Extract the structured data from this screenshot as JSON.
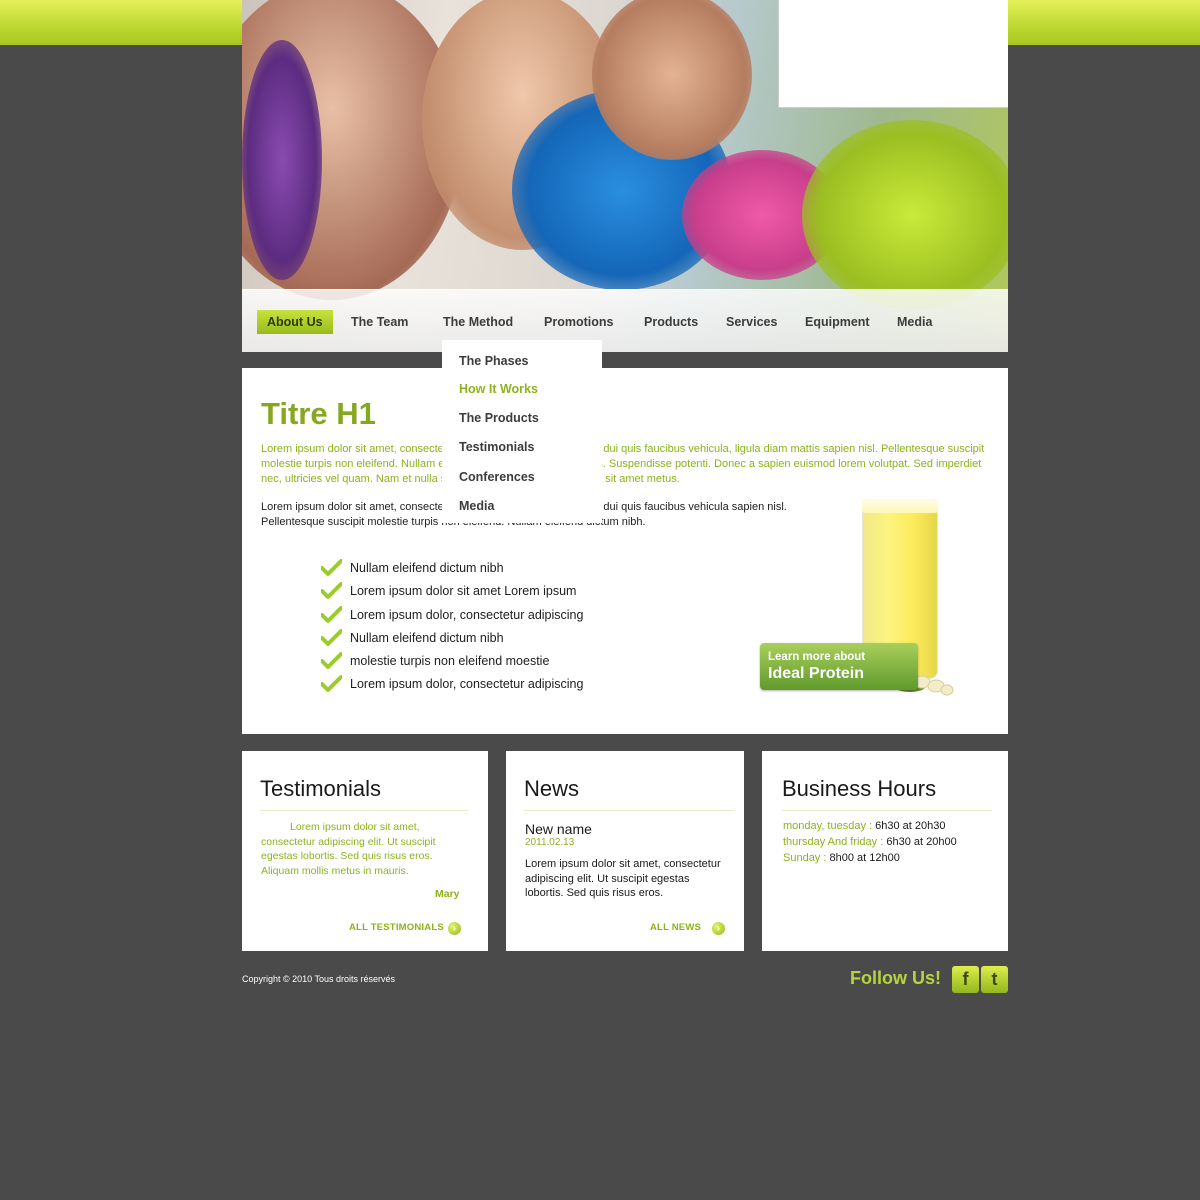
{
  "nav": {
    "items": [
      {
        "label": "About Us"
      },
      {
        "label": "The Team"
      },
      {
        "label": "The Method"
      },
      {
        "label": "Promotions"
      },
      {
        "label": "Products"
      },
      {
        "label": "Services"
      },
      {
        "label": "Equipment"
      },
      {
        "label": "Media"
      }
    ],
    "active": "About Us"
  },
  "dropdown": {
    "items": [
      {
        "label": "The Phases"
      },
      {
        "label": "How It Works"
      },
      {
        "label": "The Products"
      },
      {
        "label": "Testimonials"
      },
      {
        "label": "Conferences"
      },
      {
        "label": "Media"
      }
    ],
    "highlighted": "How It Works"
  },
  "main": {
    "title": "Titre H1",
    "lead": "Lorem ipsum dolor sit amet, consectetur adipiscing elit. Nam rhoncus, dui quis faucibus vehicula, ligula diam mattis sapien nisl. Pellentesque suscipit molestie turpis non eleifend. Nullam eleifend dictum nibh vitae ultricies. Suspendisse potenti. Donec a sapien euismod lorem volutpat. Sed imperdiet nec, ultricies vel quam. Nam et nulla sit amet risus aliquam vehicula in sit amet metus.",
    "body": "Lorem ipsum dolor sit amet, consectetur adipiscing elit. Nam rhoncus, dui quis faucibus vehicula sapien nisl. Pellentesque suscipit molestie turpis non eleifend. Nullam eleifend dictum nibh.",
    "checklist": [
      "Nullam eleifend dictum nibh",
      "Lorem ipsum dolor sit amet Lorem ipsum",
      "Lorem ipsum dolor, consectetur adipiscing",
      "Nullam eleifend dictum nibh",
      "molestie turpis non eleifend moestie",
      "Lorem ipsum dolor, consectetur adipiscing"
    ],
    "promo": {
      "line1": "Learn more about",
      "line2": "Ideal Protein"
    }
  },
  "testimonials": {
    "title": "Testimonials",
    "quote": "Lorem ipsum dolor sit amet, consectetur adipiscing elit.  Ut suscipit egestas lobortis. Sed quis risus eros. Aliquam mollis metus in mauris.",
    "author": "Mary",
    "link": "ALL TESTIMONIALS"
  },
  "news": {
    "title": "News",
    "name": "New name",
    "date": "2011.02.13",
    "text": "Lorem ipsum dolor sit amet, consectetur adipiscing elit. Ut suscipit egestas lobortis. Sed quis risus eros.",
    "link": "ALL NEWS"
  },
  "hours": {
    "title": "Business Hours",
    "rows": [
      {
        "day": "monday, tuesday :",
        "time": " 6h30 at 20h30"
      },
      {
        "day": "thursday And friday :",
        "time": " 6h30 at 20h00"
      },
      {
        "day": "Sunday :",
        "time": " 8h00 at 12h00"
      }
    ]
  },
  "footer": {
    "copyright": "Copyright © 2010  Tous droits réservés",
    "follow": "Follow Us!",
    "facebook_glyph": "f",
    "twitter_glyph": "t"
  },
  "colors": {
    "accent": "#8cb21c",
    "background": "#4a4a4a",
    "topbar": "#c4df33"
  }
}
